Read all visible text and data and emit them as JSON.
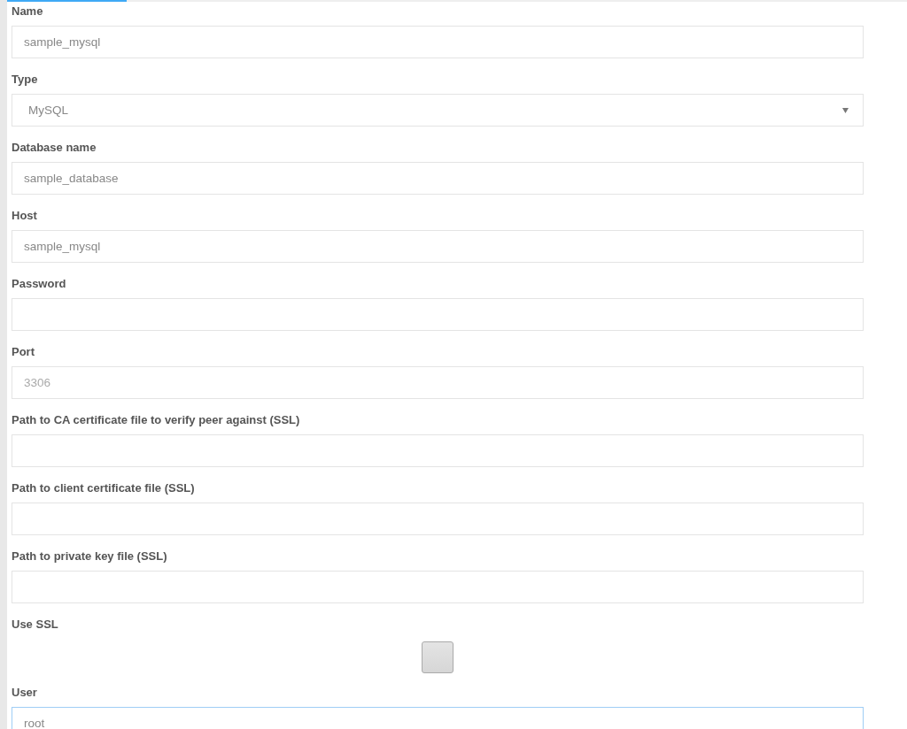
{
  "fields": [
    {
      "kind": "text",
      "label": "Name",
      "value": "sample_mysql",
      "focused": false
    },
    {
      "kind": "select",
      "label": "Type",
      "value": "MySQL",
      "focused": false
    },
    {
      "kind": "text",
      "label": "Database name",
      "value": "sample_database",
      "focused": false
    },
    {
      "kind": "text",
      "label": "Host",
      "value": "sample_mysql",
      "focused": false
    },
    {
      "kind": "text",
      "label": "Password",
      "focused": false
    },
    {
      "kind": "text",
      "label": "Port",
      "placeholder": "3306",
      "focused": false
    },
    {
      "kind": "text",
      "label": "Path to CA certificate file to verify peer against (SSL)",
      "focused": false
    },
    {
      "kind": "text",
      "label": "Path to client certificate file (SSL)",
      "focused": false
    },
    {
      "kind": "text",
      "label": "Path to private key file (SSL)",
      "focused": false
    },
    {
      "kind": "checkbox",
      "label": "Use SSL",
      "checked": false
    },
    {
      "kind": "text",
      "label": "User",
      "value": "root",
      "focused": true
    }
  ]
}
